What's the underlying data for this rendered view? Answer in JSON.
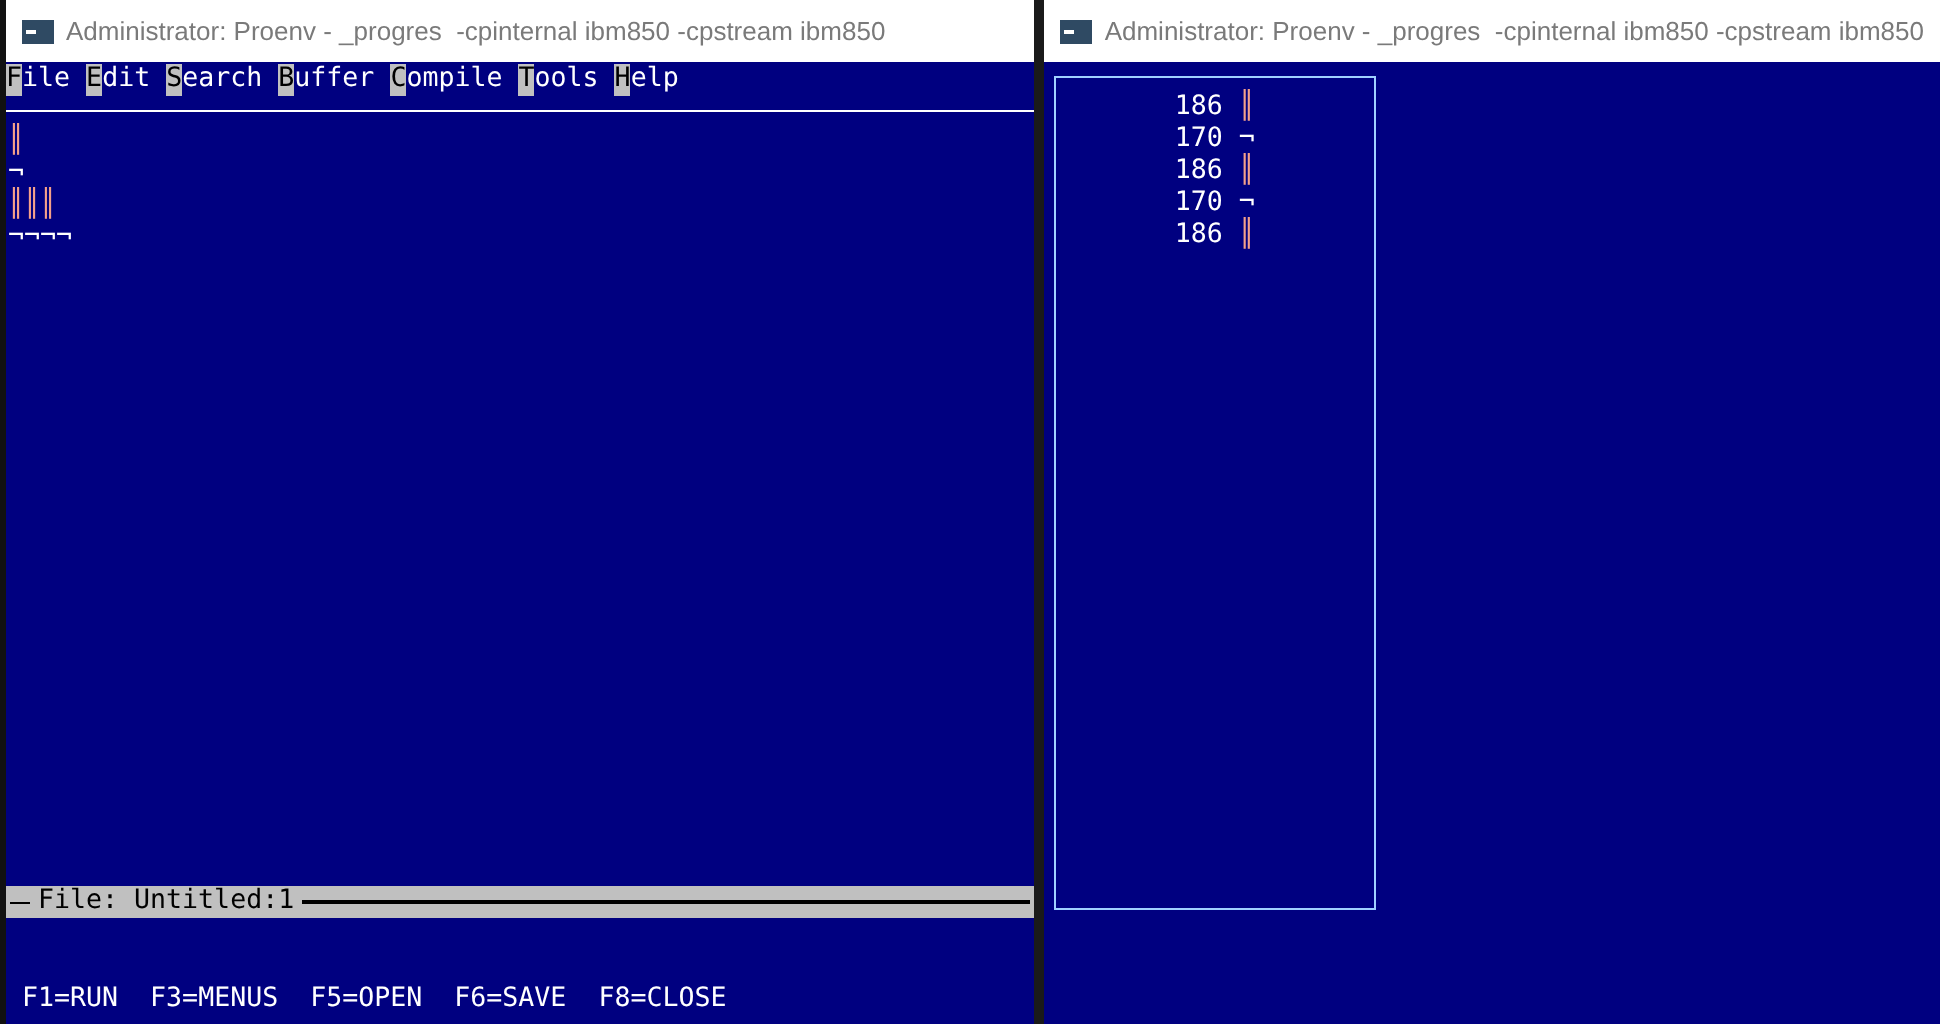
{
  "windows": [
    {
      "title": "Administrator: Proenv - _progres  -cpinternal ibm850 -cpstream ibm850",
      "menu": [
        {
          "key": "F",
          "rest": "ile"
        },
        {
          "key": "E",
          "rest": "dit"
        },
        {
          "key": "S",
          "rest": "earch"
        },
        {
          "key": "B",
          "rest": "uffer"
        },
        {
          "key": "C",
          "rest": "ompile"
        },
        {
          "key": "T",
          "rest": "ools"
        },
        {
          "key": "H",
          "rest": "elp"
        }
      ],
      "editor_lines": [
        {
          "kind": "bar",
          "text": "║"
        },
        {
          "kind": "plain",
          "text": "¬"
        },
        {
          "kind": "bar",
          "text": "║║║"
        },
        {
          "kind": "plain",
          "text": "¬¬¬¬"
        }
      ],
      "status_line": "File: Untitled:1",
      "function_keys": [
        "F1=RUN",
        "F3=MENUS",
        "F5=OPEN",
        "F6=SAVE",
        "F8=CLOSE"
      ]
    },
    {
      "title": "Administrator: Proenv - _progres  -cpinternal ibm850 -cpstream ibm850",
      "rows": [
        {
          "code": "186",
          "char": "║",
          "kind": "bar"
        },
        {
          "code": "170",
          "char": "¬",
          "kind": "plain"
        },
        {
          "code": "186",
          "char": "║",
          "kind": "bar"
        },
        {
          "code": "170",
          "char": "¬",
          "kind": "plain"
        },
        {
          "code": "186",
          "char": "║",
          "kind": "bar"
        }
      ]
    }
  ]
}
